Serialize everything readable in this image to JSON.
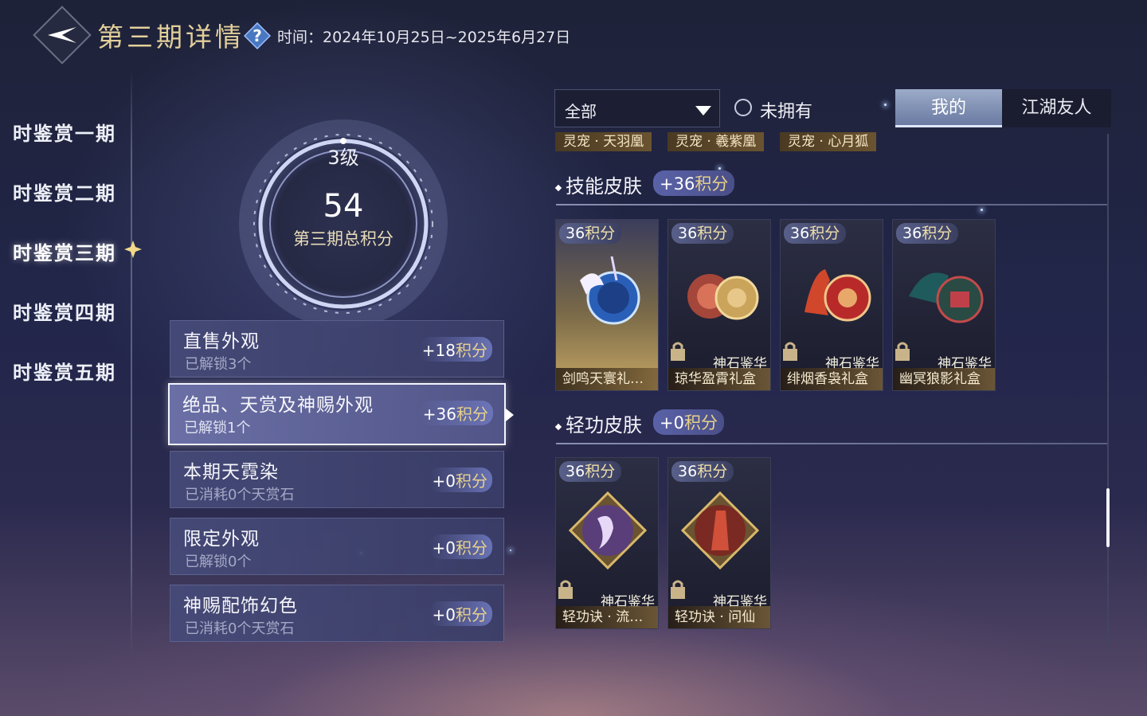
{
  "header": {
    "title": "第三期详情",
    "period_label": "时间：",
    "period_value": "2024年10月25日~2025年6月27日"
  },
  "sidebar": {
    "items": [
      {
        "label": "时鉴赏一期"
      },
      {
        "label": "时鉴赏二期"
      },
      {
        "label": "时鉴赏三期",
        "active": true
      },
      {
        "label": "时鉴赏四期"
      },
      {
        "label": "时鉴赏五期"
      }
    ]
  },
  "score": {
    "level": "3级",
    "total": "54",
    "label": "第三期总积分"
  },
  "categories": [
    {
      "title": "直售外观",
      "sub": "已解锁3个",
      "points_prefix": "+18",
      "points_unit": "积分"
    },
    {
      "title": "绝品、天赏及神赐外观",
      "sub": "已解锁1个",
      "points_prefix": "+36",
      "points_unit": "积分",
      "active": true
    },
    {
      "title": "本期天霓染",
      "sub": "已消耗0个天赏石",
      "points_prefix": "+0",
      "points_unit": "积分"
    },
    {
      "title": "限定外观",
      "sub": "已解锁0个",
      "points_prefix": "+0",
      "points_unit": "积分"
    },
    {
      "title": "神赐配饰幻色",
      "sub": "已消耗0个天赏石",
      "points_prefix": "+0",
      "points_unit": "积分"
    }
  ],
  "filters": {
    "dropdown_value": "全部",
    "unowned_label": "未拥有",
    "tab_mine": "我的",
    "tab_friends": "江湖友人"
  },
  "pet_tags": [
    "灵宠 · 天羽凰",
    "灵宠 · 羲紫凰",
    "灵宠 · 心月狐"
  ],
  "sections": [
    {
      "title": "技能皮肤",
      "points_prefix": "+36",
      "points_unit": "积分",
      "items": [
        {
          "pts_num": "36",
          "pts_unit": "积分",
          "source": "",
          "name": "剑鸣天寰礼…",
          "locked": false
        },
        {
          "pts_num": "36",
          "pts_unit": "积分",
          "source": "神石鉴华",
          "name": "琼华盈霄礼盒",
          "locked": true
        },
        {
          "pts_num": "36",
          "pts_unit": "积分",
          "source": "神石鉴华",
          "name": "绯烟香袅礼盒",
          "locked": true
        },
        {
          "pts_num": "36",
          "pts_unit": "积分",
          "source": "神石鉴华",
          "name": "幽冥狼影礼盒",
          "locked": true
        }
      ]
    },
    {
      "title": "轻功皮肤",
      "points_prefix": "+0",
      "points_unit": "积分",
      "items": [
        {
          "pts_num": "36",
          "pts_unit": "积分",
          "source": "神石鉴华",
          "name": "轻功诀 · 流…",
          "locked": true
        },
        {
          "pts_num": "36",
          "pts_unit": "积分",
          "source": "神石鉴华",
          "name": "轻功诀 · 问仙",
          "locked": true
        }
      ]
    }
  ],
  "colors": {
    "gold": "#e2cf9a",
    "accent_points": "#e8d28a",
    "tab_active": "#8596bb",
    "panel": "#464a78"
  }
}
